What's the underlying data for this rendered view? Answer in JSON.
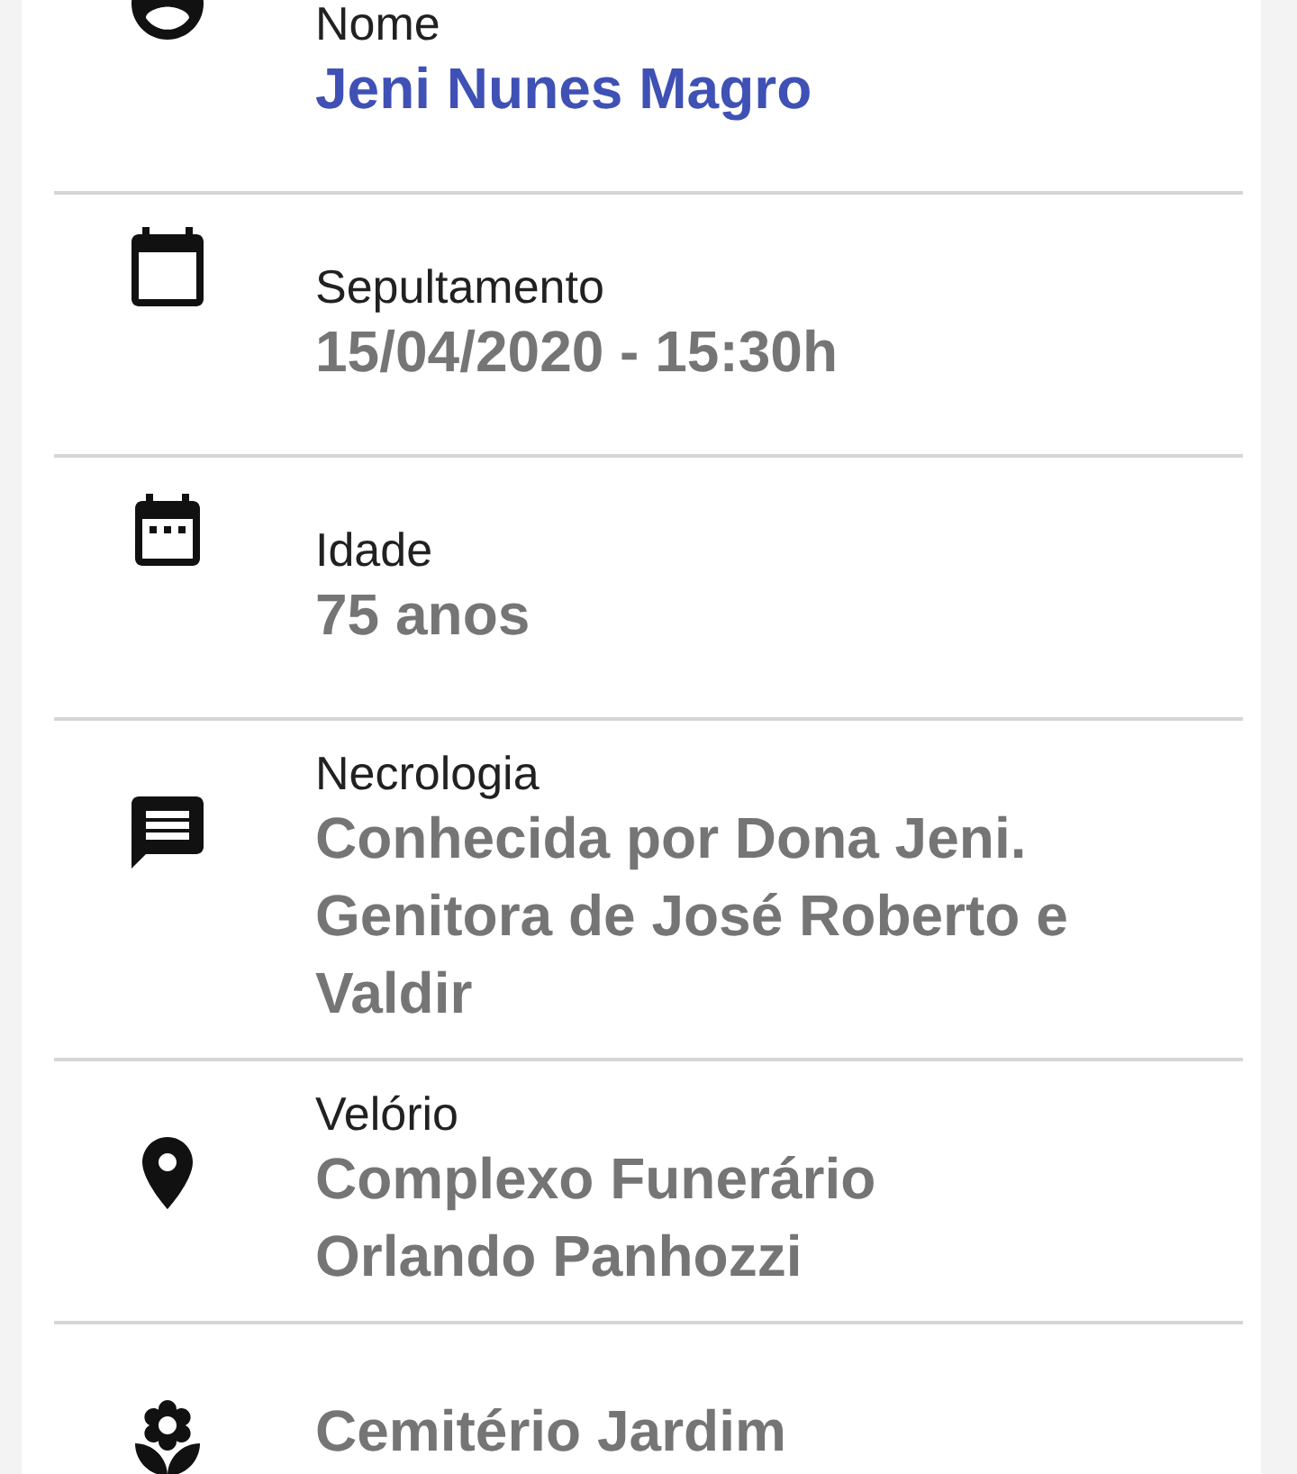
{
  "details": [
    {
      "kind": "person",
      "label": "Nome",
      "value_lines": [
        "Jeni Nunes Magro"
      ],
      "highlighted": true
    },
    {
      "kind": "calendar",
      "label": "Sepultamento",
      "value_lines": [
        "15/04/2020 - 15:30h"
      ],
      "highlighted": false
    },
    {
      "kind": "event",
      "label": "Idade",
      "value_lines": [
        "75 anos"
      ],
      "highlighted": false
    },
    {
      "kind": "message",
      "label": "Necrologia",
      "value_lines": [
        "Conhecida por Dona Jeni.",
        "Genitora de José Roberto e",
        "Valdir"
      ],
      "highlighted": false
    },
    {
      "kind": "place",
      "label": "Velório",
      "value_lines": [
        "Complexo Funerário",
        "Orlando Panhozzi"
      ],
      "highlighted": false
    },
    {
      "kind": "flower",
      "value_lines": [
        "Cemitério Jardim"
      ],
      "highlighted": false
    }
  ]
}
